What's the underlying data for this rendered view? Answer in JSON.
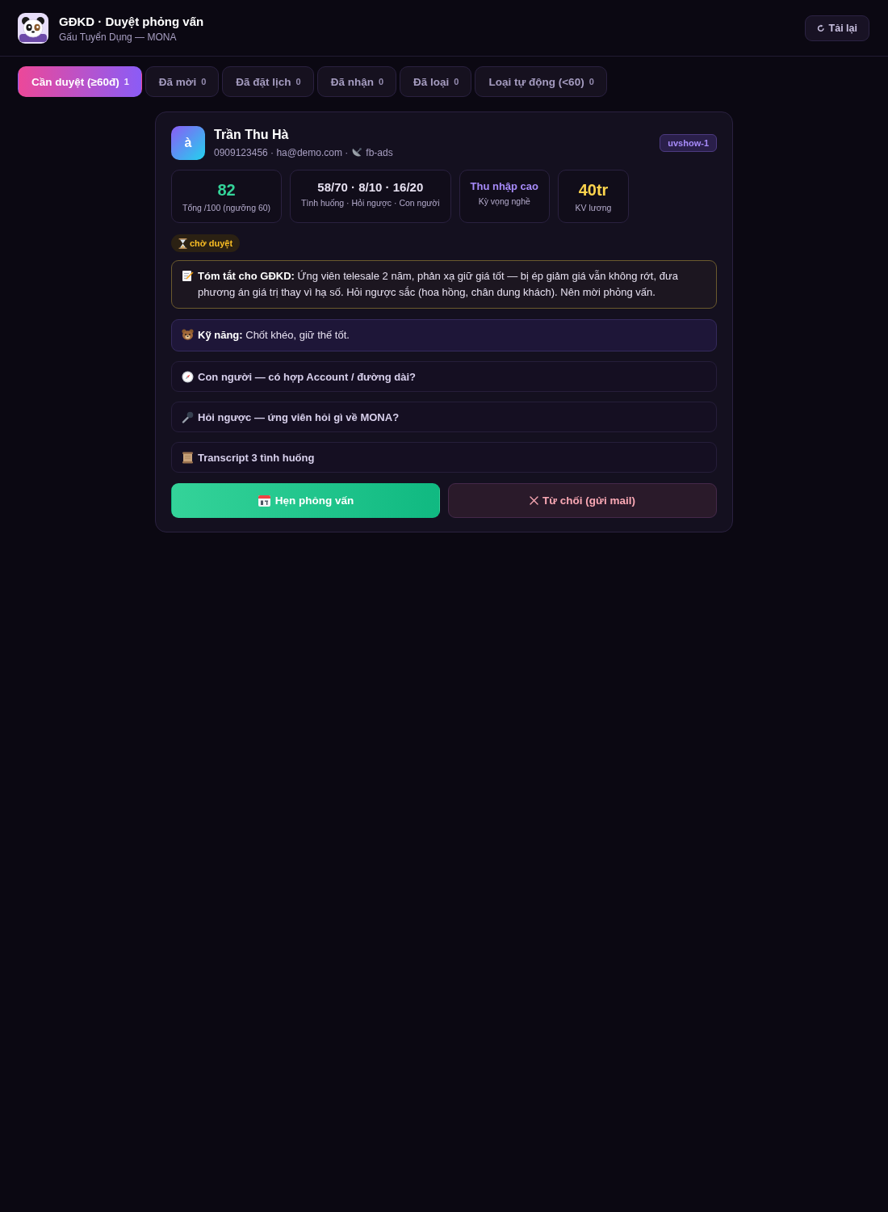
{
  "header": {
    "title": "GĐKD · Duyệt phỏng vấn",
    "subtitle": "Gấu Tuyển Dụng — MONA",
    "reload_button": "Tải lại"
  },
  "tabs": [
    {
      "label": "Cần duyệt (≥60đ)",
      "count": "1",
      "selected": true
    },
    {
      "label": "Đã mời",
      "count": "0",
      "selected": false
    },
    {
      "label": "Đã đặt lịch",
      "count": "0",
      "selected": false
    },
    {
      "label": "Đã nhận",
      "count": "0",
      "selected": false
    },
    {
      "label": "Đã loại",
      "count": "0",
      "selected": false
    },
    {
      "label": "Loại tự động (<60)",
      "count": "0",
      "selected": false
    }
  ],
  "candidate": {
    "avatar_letter": "à",
    "name": "Trần Thu Hà",
    "contact_line": "0909123456 · ha@demo.com ·",
    "source": "fb-ads",
    "badge": "uvshow-1",
    "stats": [
      {
        "kind": "score",
        "value": "82",
        "label": "Tổng /100 (ngưỡng 60)"
      },
      {
        "kind": "breakdown",
        "value": "58/70 · 8/10 · 16/20",
        "label": "Tình huống · Hỏi ngược · Con người"
      },
      {
        "kind": "tag",
        "value": "Thu nhập cao",
        "label": "Kỳ vọng nghề"
      },
      {
        "kind": "amount",
        "value": "40tr",
        "label": "KV lương"
      }
    ],
    "status": "chờ duyệt",
    "summary": "**Tóm tắt cho GĐKD:** Ứng viên telesale 2 năm, phản xạ giữ giá tốt — bị ép giảm giá vẫn không rớt, đưa phương án giá trị thay vì hạ số. Hỏi ngược sắc (hoa hồng, chân dung khách). Nên mời phỏng vấn.",
    "skills": "**Kỹ năng:** Chốt khéo, giữ thế tốt.",
    "sections": [
      {
        "kind": "compass",
        "title": "Con người — có hợp Account / đường dài?"
      },
      {
        "kind": "microphone",
        "title": "Hỏi ngược — ứng viên hỏi gì về MONA?"
      },
      {
        "kind": "scroll",
        "title": "Transcript 3 tình huống"
      }
    ],
    "actions": [
      {
        "kind": "schedule",
        "label": "Hẹn phỏng vấn"
      },
      {
        "kind": "reject",
        "label": "Từ chối (gửi mail)"
      }
    ]
  }
}
